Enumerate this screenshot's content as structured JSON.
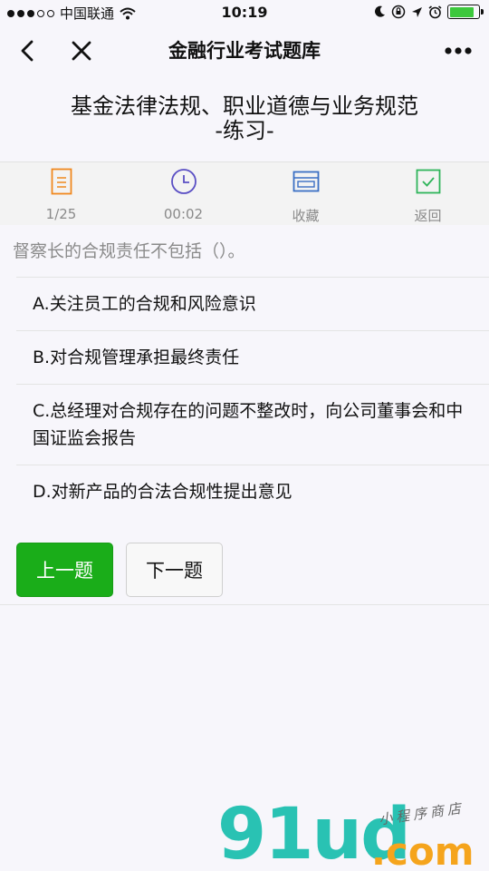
{
  "status_bar": {
    "carrier": "中国联通",
    "time": "10:19",
    "battery_level": 0.85,
    "icons": [
      "signal-dots-icon",
      "wifi-icon",
      "moon-icon",
      "lock-rotation-icon",
      "location-icon",
      "alarm-icon",
      "battery-icon"
    ]
  },
  "nav": {
    "title": "金融行业考试题库",
    "back_icon": "chevron-left-icon",
    "close_icon": "close-icon",
    "more_icon": "more-dots-icon"
  },
  "exam": {
    "title_line1": "基金法律法规、职业道德与业务规范",
    "title_line2": "-练习-"
  },
  "toolbar": {
    "items": [
      {
        "icon": "document-icon",
        "label": "1/25",
        "color": "#f0891e"
      },
      {
        "icon": "clock-icon",
        "label": "00:02",
        "color": "#5a4fc4"
      },
      {
        "icon": "bookmark-icon",
        "label": "收藏",
        "color": "#3a6fc4"
      },
      {
        "icon": "check-box-icon",
        "label": "返回",
        "color": "#2fb45a"
      }
    ]
  },
  "question": {
    "text": "督察长的合规责任不包括（）。",
    "options": [
      "A.关注员工的合规和风险意识",
      "B.对合规管理承担最终责任",
      "C.总经理对合规存在的问题不整改时，向公司董事会和中国证监会报告",
      "D.对新产品的合法合规性提出意见"
    ]
  },
  "buttons": {
    "prev_label": "上一题",
    "next_label": "下一题"
  },
  "watermark": {
    "brand": "91ud",
    "suffix": ".com",
    "tagline": "小程序商店"
  },
  "colors": {
    "accent_green": "#1aad19",
    "background": "#f7f6fb"
  }
}
